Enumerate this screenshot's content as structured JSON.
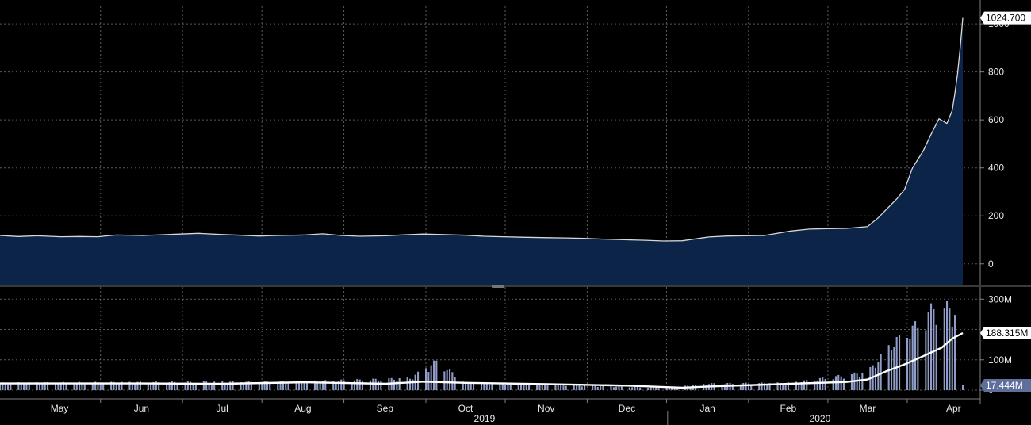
{
  "colors": {
    "background": "#000000",
    "grid": "#5a5a5a",
    "price_fill": "#0b2447",
    "price_line": "#d8d8d8",
    "volume_bar": "#8f9dc8",
    "volume_ma": "#ffffff",
    "label_box": "#ffffff",
    "label_text": "#000000",
    "volume_label_box": "#5f6f9c",
    "axis_text": "#e8e8e8",
    "divider": "#808080"
  },
  "chart_data": [
    {
      "type": "area",
      "panel": "price",
      "x_start": "2019-04-08",
      "x_end": "2020-04-06",
      "ylim": [
        -90,
        1040
      ],
      "yticks": [
        0,
        200,
        400,
        600,
        800,
        1000
      ],
      "ytick_labels": [
        "0",
        "200",
        "400",
        "600",
        "800",
        "1000"
      ],
      "last_value_label": "1024.700",
      "series": [
        {
          "points": [
            [
              "2019-04-08",
              118
            ],
            [
              "2019-04-15",
              114
            ],
            [
              "2019-04-22",
              117
            ],
            [
              "2019-05-01",
              113
            ],
            [
              "2019-05-08",
              114
            ],
            [
              "2019-05-15",
              113
            ],
            [
              "2019-05-22",
              120
            ],
            [
              "2019-06-01",
              118
            ],
            [
              "2019-06-08",
              121
            ],
            [
              "2019-06-15",
              124
            ],
            [
              "2019-06-22",
              127
            ],
            [
              "2019-07-01",
              122
            ],
            [
              "2019-07-08",
              119
            ],
            [
              "2019-07-15",
              116
            ],
            [
              "2019-07-22",
              118
            ],
            [
              "2019-08-01",
              120
            ],
            [
              "2019-08-08",
              125
            ],
            [
              "2019-08-15",
              118
            ],
            [
              "2019-08-22",
              115
            ],
            [
              "2019-09-01",
              117
            ],
            [
              "2019-09-08",
              121
            ],
            [
              "2019-09-15",
              124
            ],
            [
              "2019-09-22",
              122
            ],
            [
              "2019-10-01",
              119
            ],
            [
              "2019-10-08",
              115
            ],
            [
              "2019-10-15",
              113
            ],
            [
              "2019-10-22",
              111
            ],
            [
              "2019-11-01",
              109
            ],
            [
              "2019-11-08",
              108
            ],
            [
              "2019-11-15",
              106
            ],
            [
              "2019-11-22",
              103
            ],
            [
              "2019-12-01",
              100
            ],
            [
              "2019-12-08",
              98
            ],
            [
              "2019-12-15",
              95
            ],
            [
              "2019-12-22",
              96
            ],
            [
              "2020-01-01",
              112
            ],
            [
              "2020-01-08",
              116
            ],
            [
              "2020-01-15",
              117
            ],
            [
              "2020-01-22",
              118
            ],
            [
              "2020-02-01",
              137
            ],
            [
              "2020-02-08",
              145
            ],
            [
              "2020-02-15",
              147
            ],
            [
              "2020-02-22",
              148
            ],
            [
              "2020-03-01",
              155
            ],
            [
              "2020-03-05",
              192
            ],
            [
              "2020-03-08",
              226
            ],
            [
              "2020-03-12",
              270
            ],
            [
              "2020-03-15",
              310
            ],
            [
              "2020-03-18",
              400
            ],
            [
              "2020-03-22",
              470
            ],
            [
              "2020-03-25",
              540
            ],
            [
              "2020-03-28",
              605
            ],
            [
              "2020-03-31",
              585
            ],
            [
              "2020-04-02",
              640
            ],
            [
              "2020-04-03",
              710
            ],
            [
              "2020-04-04",
              790
            ],
            [
              "2020-04-05",
              900
            ],
            [
              "2020-04-06",
              1024.7
            ]
          ]
        }
      ]
    },
    {
      "type": "bar",
      "panel": "volume",
      "x_start": "2019-04-08",
      "x_end": "2020-04-06",
      "ylim": [
        0,
        340
      ],
      "unit": "M",
      "yticks": [
        0,
        100,
        200,
        300
      ],
      "ytick_labels": [
        "0",
        "100M",
        "",
        "300M"
      ],
      "ma_last_label": "188.315M",
      "volume_last_label": "17.444M",
      "moving_average_points": [
        [
          "2019-04-08",
          22
        ],
        [
          "2019-05-01",
          22
        ],
        [
          "2019-06-01",
          22
        ],
        [
          "2019-07-01",
          21
        ],
        [
          "2019-08-01",
          26
        ],
        [
          "2019-09-01",
          21
        ],
        [
          "2019-09-15",
          28
        ],
        [
          "2019-10-01",
          24
        ],
        [
          "2019-11-01",
          20
        ],
        [
          "2019-12-01",
          15
        ],
        [
          "2019-12-22",
          8
        ],
        [
          "2020-01-01",
          12
        ],
        [
          "2020-02-01",
          21
        ],
        [
          "2020-02-22",
          27
        ],
        [
          "2020-03-01",
          35
        ],
        [
          "2020-03-08",
          62
        ],
        [
          "2020-03-15",
          85
        ],
        [
          "2020-03-22",
          112
        ],
        [
          "2020-03-29",
          140
        ],
        [
          "2020-04-02",
          170
        ],
        [
          "2020-04-06",
          188.3
        ]
      ],
      "bar_profile": [
        [
          "2019-04-08",
          22
        ],
        [
          "2019-08-01",
          26
        ],
        [
          "2019-09-10",
          36
        ],
        [
          "2019-09-20",
          88
        ],
        [
          "2019-10-01",
          23
        ],
        [
          "2019-11-01",
          17
        ],
        [
          "2019-12-10",
          8
        ],
        [
          "2019-12-20",
          10
        ],
        [
          "2020-01-01",
          20
        ],
        [
          "2020-02-01",
          22
        ],
        [
          "2020-03-01",
          55
        ],
        [
          "2020-03-10",
          140
        ],
        [
          "2020-03-20",
          200
        ],
        [
          "2020-03-27",
          260
        ],
        [
          "2020-04-03",
          240
        ],
        [
          "2020-04-06",
          17.444
        ]
      ]
    }
  ],
  "x_axis": {
    "months": [
      {
        "label": "May",
        "date": "2019-05-01"
      },
      {
        "label": "Jun",
        "date": "2019-06-01"
      },
      {
        "label": "Jul",
        "date": "2019-07-01"
      },
      {
        "label": "Aug",
        "date": "2019-08-01"
      },
      {
        "label": "Sep",
        "date": "2019-09-01"
      },
      {
        "label": "Oct",
        "date": "2019-10-01"
      },
      {
        "label": "Nov",
        "date": "2019-11-01"
      },
      {
        "label": "Dec",
        "date": "2019-12-01"
      },
      {
        "label": "Jan",
        "date": "2020-01-01"
      },
      {
        "label": "Feb",
        "date": "2020-02-01"
      },
      {
        "label": "Mar",
        "date": "2020-03-01"
      },
      {
        "label": "Apr",
        "date": "2020-04-01"
      }
    ],
    "years": [
      {
        "label": "2019",
        "date": "2019-08-15"
      },
      {
        "label": "2020",
        "date": "2020-02-15"
      }
    ],
    "year_boundary": "2020-01-01"
  }
}
